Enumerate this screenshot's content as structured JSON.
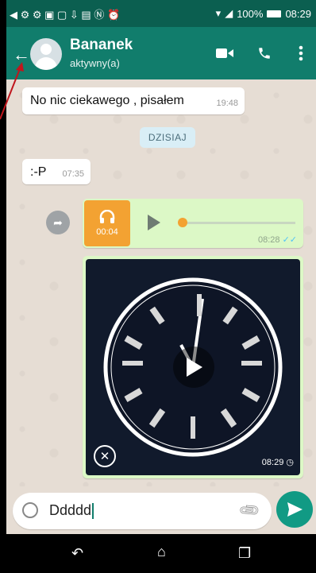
{
  "status_bar": {
    "notification_icons": "◀ ⚙ ⚙ ▣ ▢ ⇩ ▤ Ⓝ ⏰",
    "battery": "100%",
    "time": "08:29"
  },
  "header": {
    "contact_name": "Bananek",
    "status": "aktywny(a)",
    "icons": {
      "back": "arrow-left-icon",
      "video": "video-camera-icon",
      "call": "phone-icon",
      "menu": "more-vert-icon"
    }
  },
  "messages": {
    "msg1": {
      "text": "No nic ciekawego , pisałem",
      "time": "19:48"
    },
    "day_divider": "DZISIAJ",
    "msg2": {
      "text": ":-P",
      "time": "07:35"
    },
    "voice": {
      "duration": "00:04",
      "time": "08:28"
    },
    "video": {
      "time": "08:29"
    }
  },
  "input": {
    "value": "Ddddd"
  },
  "colors": {
    "appbar": "#117d6c",
    "statusbar": "#0b5f50",
    "outgoing": "#dcf8c6",
    "audio": "#f3a232",
    "send": "#119a84",
    "annotation": "#c0161d"
  }
}
